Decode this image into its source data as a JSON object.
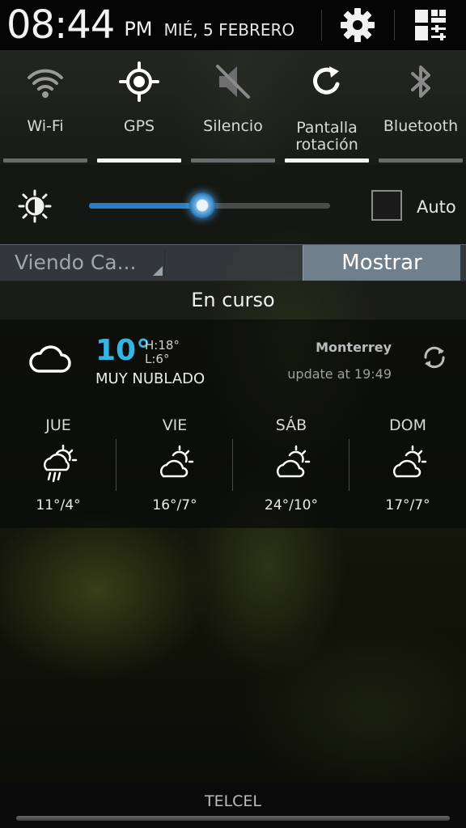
{
  "status": {
    "time": "08:44",
    "ampm": "PM",
    "date": "MIÉ, 5 FEBRERO"
  },
  "header_icons": [
    "gear-icon",
    "notification-settings-icon"
  ],
  "toggles": [
    {
      "label": "Wi-Fi",
      "icon": "wifi-icon",
      "on": false
    },
    {
      "label": "GPS",
      "icon": "gps-icon",
      "on": true
    },
    {
      "label": "Silencio",
      "icon": "mute-icon",
      "on": false
    },
    {
      "label": "Pantalla rotación",
      "line1": "Pantalla",
      "line2": "rotación",
      "icon": "rotation-icon",
      "on": true
    },
    {
      "label": "Bluetooth",
      "icon": "bluetooth-icon",
      "on": false
    }
  ],
  "brightness": {
    "level": 0.47,
    "auto_label": "Auto",
    "auto_checked": false,
    "accent": "#2b7fc4"
  },
  "notifications_bar": {
    "viewing": "Viendo Ca...",
    "show_button": "Mostrar"
  },
  "ongoing_header": "En curso",
  "weather": {
    "temp": "10°",
    "high": "H:18°",
    "low": "L:6°",
    "condition": "MUY NUBLADO",
    "city": "Monterrey",
    "updated": "update at 19:49",
    "accent": "#33b5e5",
    "forecast": [
      {
        "day": "JUE",
        "temps": "11°/4°",
        "icon": "rain-sun-icon"
      },
      {
        "day": "VIE",
        "temps": "16°/7°",
        "icon": "partly-cloudy-icon"
      },
      {
        "day": "SÁB",
        "temps": "24°/10°",
        "icon": "partly-cloudy-icon"
      },
      {
        "day": "DOM",
        "temps": "17°/7°",
        "icon": "partly-cloudy-icon"
      }
    ]
  },
  "carrier": "TELCEL"
}
